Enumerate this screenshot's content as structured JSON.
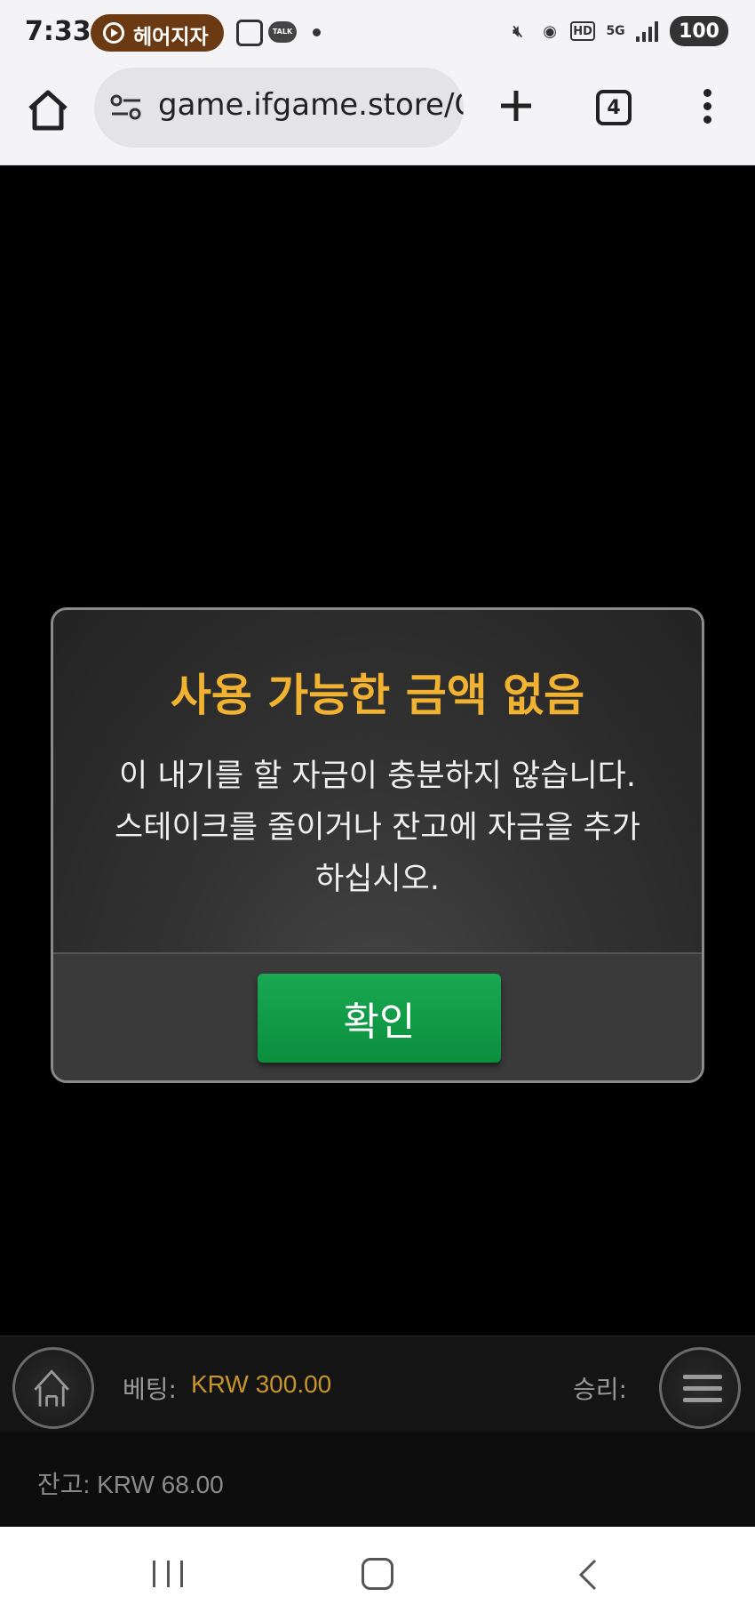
{
  "status_bar": {
    "time": "7:33",
    "pill_label": "헤어지자",
    "talk_label": "TALK",
    "network": "5G",
    "hd": "HD",
    "battery": "100"
  },
  "browser": {
    "url": "game.ifgame.store/G",
    "tab_count": "4"
  },
  "dialog": {
    "title": "사용 가능한 금액 없음",
    "message_line1": "이 내기를 할 자금이 충분하지 않습니다.",
    "message_line2": "스테이크를 줄이거나 잔고에 자금을 추가",
    "message_line3": "하십시오.",
    "ok_label": "확인"
  },
  "game_bar": {
    "bet_label": "베팅:",
    "bet_value": "KRW 300.00",
    "win_label": "승리:",
    "balance": "잔고: KRW 68.00"
  },
  "colors": {
    "title": "#f0b230",
    "ok_button": "#0a9a46",
    "bet_value": "#c8952b"
  },
  "icons": [
    "home-icon",
    "site-settings-icon",
    "new-tab-icon",
    "tab-switcher-icon",
    "overflow-menu-icon",
    "game-home-icon",
    "game-menu-icon",
    "nav-recents-icon",
    "nav-home-icon",
    "nav-back-icon"
  ]
}
